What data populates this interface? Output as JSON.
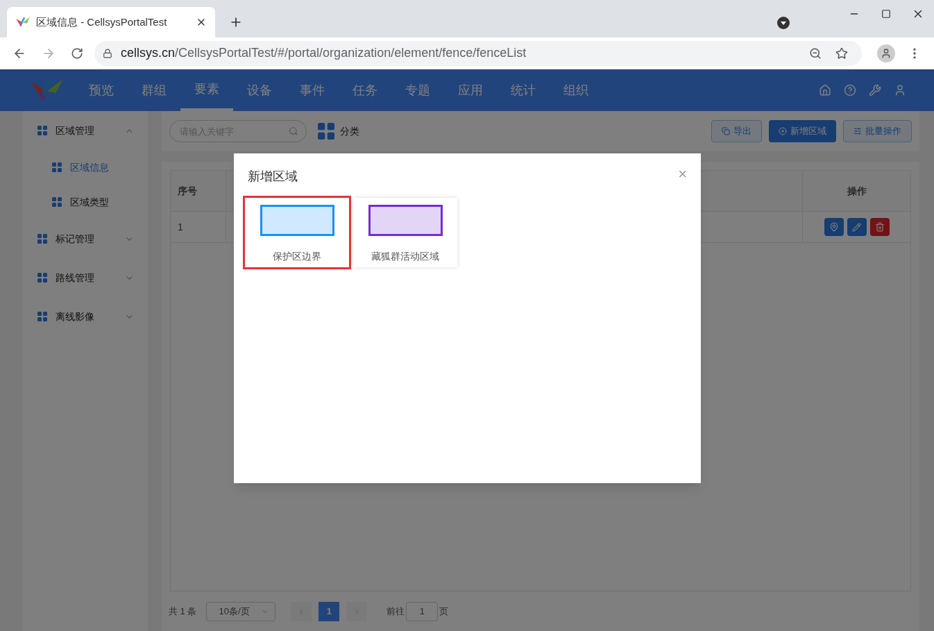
{
  "browser": {
    "tab_title": "区域信息 - CellsysPortalTest",
    "url_host": "cellsys.cn",
    "url_path": "/CellsysPortalTest/#/portal/organization/element/fence/fenceList"
  },
  "nav": {
    "items": [
      {
        "label": "预览",
        "selected": false
      },
      {
        "label": "群组",
        "selected": false
      },
      {
        "label": "要素",
        "selected": true
      },
      {
        "label": "设备",
        "selected": false
      },
      {
        "label": "事件",
        "selected": false
      },
      {
        "label": "任务",
        "selected": false
      },
      {
        "label": "专题",
        "selected": false
      },
      {
        "label": "应用",
        "selected": false
      },
      {
        "label": "统计",
        "selected": false
      },
      {
        "label": "组织",
        "selected": false
      }
    ]
  },
  "sidebar": {
    "items": [
      {
        "label": "区域管理",
        "expanded": true,
        "selected": false,
        "children": [
          {
            "label": "区域信息",
            "selected": true
          },
          {
            "label": "区域类型",
            "selected": false
          }
        ]
      },
      {
        "label": "标记管理",
        "expanded": false,
        "selected": false
      },
      {
        "label": "路线管理",
        "expanded": false,
        "selected": false
      },
      {
        "label": "离线影像",
        "expanded": false,
        "selected": false
      }
    ]
  },
  "toolbar": {
    "search": {
      "placeholder": "请输入关键字"
    },
    "category": "分类",
    "buttons": [
      {
        "label": "导出",
        "kind": "export"
      },
      {
        "label": "新增区域",
        "kind": "add"
      },
      {
        "label": "批量操作",
        "kind": "batch"
      }
    ]
  },
  "table": {
    "columns": [
      "序号",
      "操作"
    ],
    "rows": [
      {
        "index": "1"
      }
    ]
  },
  "pagination": {
    "total": "共 1 条",
    "page_size": "10条/页",
    "pages": [
      {
        "label": "1",
        "selected": true
      }
    ],
    "goto_label": "前往",
    "goto_value": "1",
    "page_unit": "页"
  },
  "modal": {
    "title": "新增区域",
    "close": "×",
    "options": [
      {
        "label": "保护区边界",
        "color": "#1890ff",
        "selected": true
      },
      {
        "label": "藏狐群活动区域",
        "color": "#722ed1",
        "selected": false
      }
    ]
  }
}
